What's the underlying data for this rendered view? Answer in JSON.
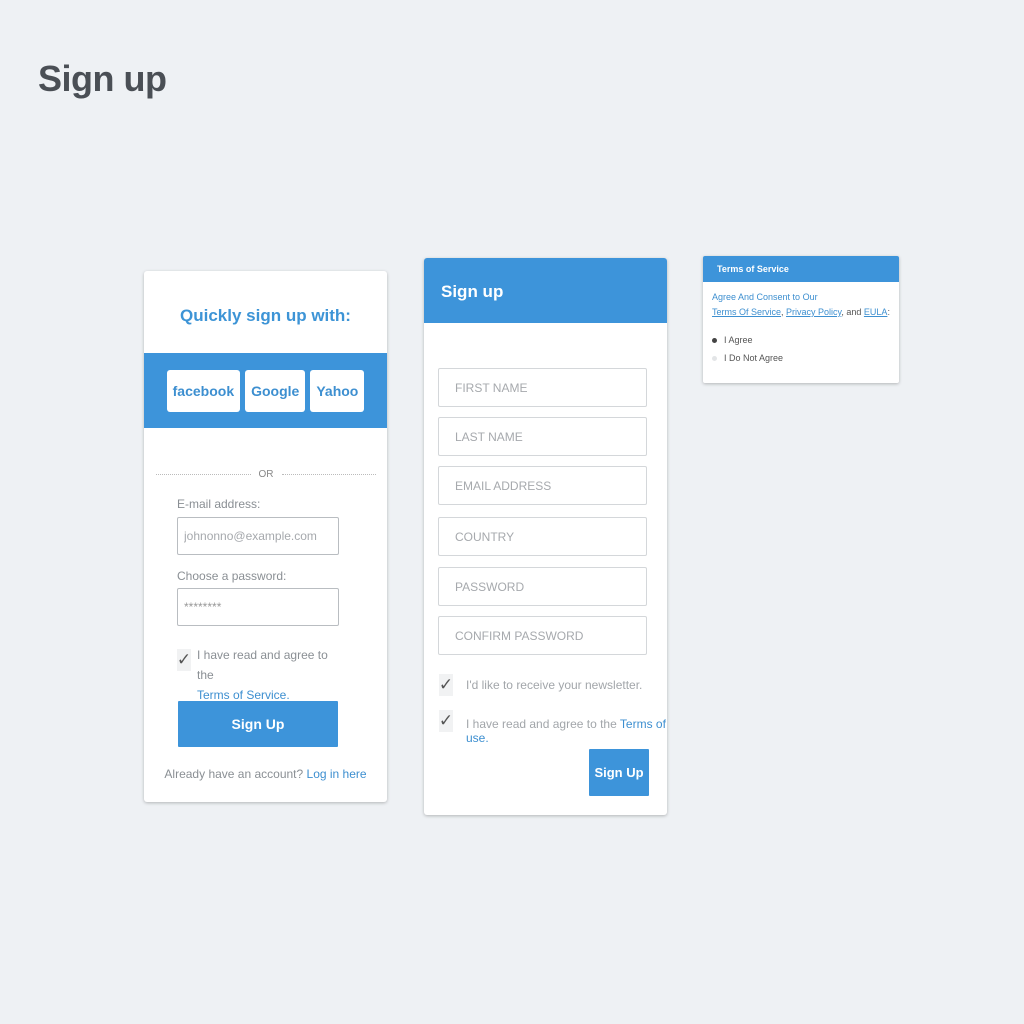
{
  "page": {
    "title": "Sign up"
  },
  "card1": {
    "quick_title": "Quickly sign up with:",
    "social": [
      "facebook",
      "Google",
      "Yahoo"
    ],
    "or": "OR",
    "email_label": "E-mail address:",
    "email_placeholder": "johnonno@example.com",
    "password_label": "Choose a password:",
    "password_value": "********",
    "agree_checked": true,
    "agree_text": "I have read and agree to the",
    "agree_link": "Terms of Service.",
    "signup_label": "Sign Up",
    "already_text": "Already have an account?",
    "login_link": "Log in here"
  },
  "card2": {
    "title": "Sign up",
    "fields": [
      {
        "placeholder": "FIRST NAME"
      },
      {
        "placeholder": "LAST NAME"
      },
      {
        "placeholder": "EMAIL ADDRESS"
      },
      {
        "placeholder": "COUNTRY"
      },
      {
        "placeholder": "PASSWORD"
      },
      {
        "placeholder": "CONFIRM PASSWORD"
      }
    ],
    "newsletter_checked": true,
    "newsletter_label": "I'd like to receive your newsletter.",
    "terms_checked": true,
    "terms_text": "I have read and agree to the",
    "terms_link": "Terms of use.",
    "signup_label": "Sign Up"
  },
  "card3": {
    "title": "Terms of Service",
    "intro": "Agree And Consent to Our",
    "link1": "Terms Of Service",
    "sep1": ", ",
    "link2": "Privacy Policy",
    "sep2": ", and ",
    "link3": "EULA",
    "end": ":",
    "options": [
      {
        "label": "I Agree",
        "selected": true
      },
      {
        "label": "I Do Not Agree",
        "selected": false
      }
    ]
  },
  "colors": {
    "accent": "#3d94da",
    "background": "#eef1f4"
  }
}
